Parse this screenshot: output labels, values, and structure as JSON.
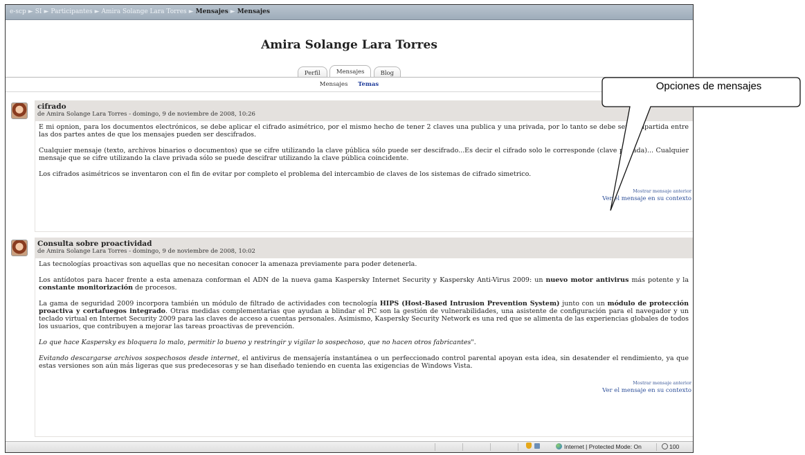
{
  "breadcrumb": {
    "items": [
      "e-scp",
      "SI",
      "Participantes",
      "Amira Solange Lara Torres",
      "Mensajes",
      "Mensajes"
    ],
    "separator": "►"
  },
  "profile": {
    "name": "Amira Solange Lara Torres"
  },
  "tabs": {
    "perfil": "Perfil",
    "mensajes": "Mensajes",
    "blog": "Blog"
  },
  "subtabs": {
    "mensajes": "Mensajes",
    "temas": "Temas"
  },
  "posts": [
    {
      "subject": "cifrado",
      "author_line": "de Amira Solange Lara Torres - domingo, 9 de noviembre de 2008, 10:26",
      "paragraphs": [
        "E mi opnion, para los documentos electrónicos, se debe aplicar el cifrado asimétrico, por el mismo hecho de tener 2 claves una publica y una privada, por lo tanto se debe ser compartida entre las dos partes antes de que los mensajes pueden ser descifrados.",
        "Cualquier mensaje (texto, archivos binarios o documentos) que se cifre utilizando la clave pública sólo puede ser descifrado...Es decir el cifrado solo le corresponde (clave privada)... Cualquier mensaje que se cifre utilizando la clave privada sólo se puede descifrar utilizando la clave pública coincidente.",
        "Los cifrados asimétricos se inventaron con el fin de evitar por completo el problema del intercambio de claves de los sistemas de cifrado simetrico."
      ],
      "show_previous": "Mostrar mensaje anterior",
      "view_context": "Ver el mensaje en su contexto"
    },
    {
      "subject": "Consulta sobre proactividad",
      "author_line": "de Amira Solange Lara Torres - domingo, 9 de noviembre de 2008, 10:02",
      "p1": "Las tecnologías proactivas son aquellas que no necesitan conocer la amenaza previamente para poder detenerla.",
      "p2_a": "Los antídotos para hacer frente a esta amenaza conforman el ADN de la nueva gama Kaspersky Internet Security y Kaspersky Anti-Virus 2009: un ",
      "p2_b": "nuevo motor antivirus",
      "p2_c": " más potente y la ",
      "p2_d": "constante monitorización",
      "p2_e": " de procesos.",
      "p3_a": "La gama de seguridad 2009 incorpora también un módulo de filtrado de actividades con tecnología ",
      "p3_b": "HIPS (Host-Based Intrusion Prevention System)",
      "p3_c": " junto con un ",
      "p3_d": "módulo de protección proactiva y cortafuegos integrado",
      "p3_e": ". Otras medidas complementarias que ayudan a blindar el PC son la gestión de vulnerabilidades, una asistente de configuración para el navegador y un teclado virtual en Internet Security 2009 para las claves de acceso a cuentas personales. Asimismo, Kaspersky Security Network es una red que se alimenta de las experiencias globales de todos los usuarios, que contribuyen a mejorar las tareas proactivas de prevención.",
      "p4": "Lo que hace Kaspersky es bloquera lo malo, permitir lo bueno y restringir y vigilar lo sospechoso, que no hacen otros fabricantes\".",
      "p5_a": "Evitando descargarse archivos sospechosos desde internet,",
      "p5_b": " el antivirus de mensajería instantánea o un perfeccionado control parental apoyan esta idea, sin desatender el rendimiento, ya que estas versiones son aún más ligeras que sus predecesoras y se han diseñado teniendo en cuenta las exigencias de Windows Vista.",
      "show_previous": "Mostrar mensaje anterior",
      "view_context": "Ver el mensaje en su contexto"
    }
  ],
  "callout": {
    "text": "Opciones de mensajes"
  },
  "statusbar": {
    "zone": "Internet | Protected Mode: On",
    "zoom": "100"
  }
}
